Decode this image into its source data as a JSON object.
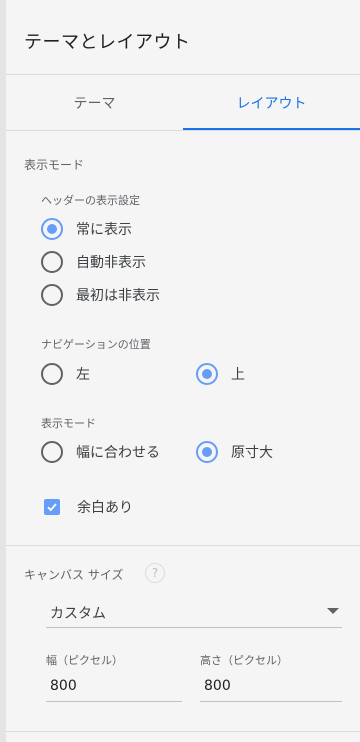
{
  "panel": {
    "title": "テーマとレイアウト"
  },
  "tabs": [
    {
      "label": "テーマ",
      "active": false
    },
    {
      "label": "レイアウト",
      "active": true
    }
  ],
  "display_mode": {
    "heading": "表示モード",
    "header_settings": {
      "label": "ヘッダーの表示設定",
      "options": [
        "常に表示",
        "自動非表示",
        "最初は非表示"
      ],
      "selected": "常に表示"
    },
    "nav_position": {
      "label": "ナビゲーションの位置",
      "options": [
        "左",
        "上"
      ],
      "selected": "上"
    },
    "view_mode": {
      "label": "表示モード",
      "options": [
        "幅に合わせる",
        "原寸大"
      ],
      "selected": "原寸大"
    },
    "margin_checkbox": {
      "label": "余白あり",
      "checked": true
    }
  },
  "canvas_size": {
    "heading": "キャンバス サイズ",
    "help_glyph": "?",
    "select_value": "カスタム",
    "width_label": "幅（ピクセル）",
    "width_value": "800",
    "height_label": "高さ（ピクセル）",
    "height_value": "800"
  },
  "colors": {
    "accent": "#1a73e8",
    "radio_checked": "#669df6",
    "background": "#f5f5f5"
  }
}
